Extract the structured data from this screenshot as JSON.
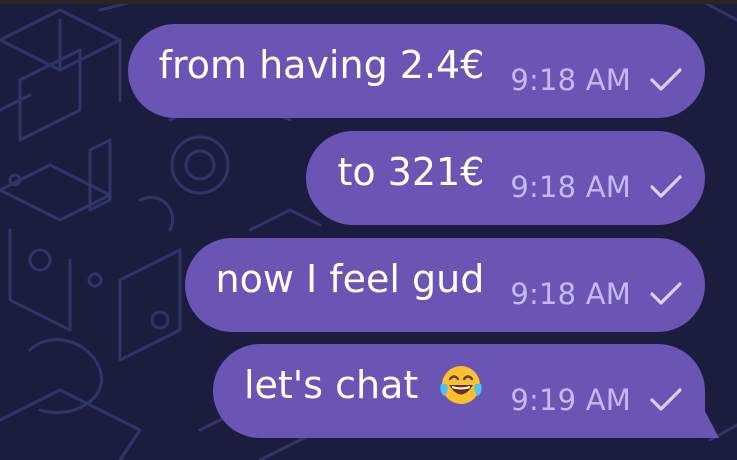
{
  "colors": {
    "background": "#1b1d3e",
    "pattern_line": "#2f3567",
    "bubble": "#6a55b5",
    "message_text": "#ffffff",
    "time_text": "#c5baf0",
    "checkmark": "#d9d2f6"
  },
  "messages": [
    {
      "text": "from having 2.4€",
      "time": "9:18 AM",
      "status_icon": "check-icon"
    },
    {
      "text": "to 321€",
      "time": "9:18 AM",
      "status_icon": "check-icon"
    },
    {
      "text": "now I feel gud",
      "time": "9:18 AM",
      "status_icon": "check-icon"
    },
    {
      "text": "let's chat",
      "time": "9:19 AM",
      "status_icon": "check-icon",
      "emoji": "face-with-tears-of-joy"
    }
  ]
}
